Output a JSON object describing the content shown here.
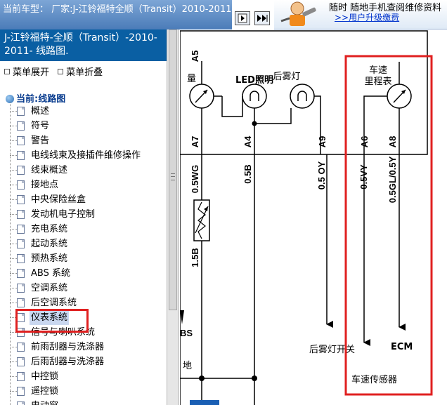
{
  "header": {
    "car_label": "当前车型：  厂家:J-江铃福特全顺（Transit）2010-2011",
    "banner_line1": "随时 随地手机查阅维修资料",
    "banner_line2": ">>用户升级缴费"
  },
  "left": {
    "doc_title": "J-江铃福特-全顺（Transit）-2010-2011- 线路图.",
    "menu_expand": "菜单展开",
    "menu_collapse": "菜单折叠",
    "tree_root": "当前:线路图",
    "items": [
      {
        "label": "概述"
      },
      {
        "label": "符号"
      },
      {
        "label": "警告"
      },
      {
        "label": "电线线束及接插件维修操作"
      },
      {
        "label": "线束概述"
      },
      {
        "label": "接地点"
      },
      {
        "label": "中央保险丝盒"
      },
      {
        "label": "发动机电子控制"
      },
      {
        "label": "充电系统"
      },
      {
        "label": "起动系统"
      },
      {
        "label": "预热系统"
      },
      {
        "label": "ABS 系统"
      },
      {
        "label": "空调系统"
      },
      {
        "label": "后空调系统"
      },
      {
        "label": "仪表系统"
      },
      {
        "label": "信号与喇叭系统"
      },
      {
        "label": "前雨刮器与洗涤器"
      },
      {
        "label": "后雨刮器与洗涤器"
      },
      {
        "label": "中控锁"
      },
      {
        "label": "遥控锁"
      },
      {
        "label": "电动窗"
      }
    ],
    "selected_item": "仪表系统"
  },
  "diagram": {
    "connector_top": "A5",
    "gauge_partial": "量",
    "led_label": "LED照明",
    "fog_lamp_label": "后雾灯",
    "speedo_line1": "车速",
    "speedo_line2": "里程表",
    "pins": [
      "A7",
      "A4",
      "A9",
      "A6",
      "A8"
    ],
    "wires": [
      "0.5WG",
      "0.5B",
      "0.5 OY",
      "0.5VY",
      "0.5GL/0.5Y"
    ],
    "wire_lower": "1.5B",
    "abs_partial": "BS",
    "ground_partial": "地",
    "fog_switch": "后雾灯开关",
    "ecm": "ECM",
    "speed_sensor": "车速传感器"
  },
  "colors": {
    "title_bg": "#0a5fa3",
    "highlight_border": "#e02020",
    "selected_bg": "#c9d7ef"
  }
}
